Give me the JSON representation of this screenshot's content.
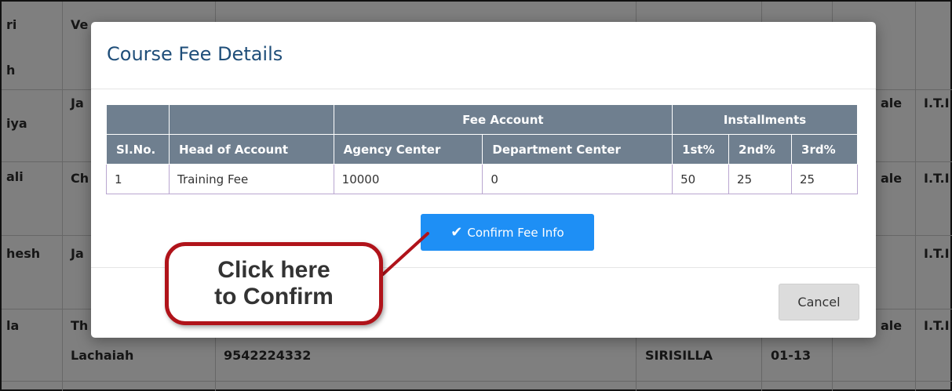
{
  "background_table": {
    "row_fragments": [
      {
        "name_col": "ri",
        "col2": "Ve"
      },
      {
        "name_col": "h"
      },
      {
        "name_col": "iya",
        "col2": "Ja",
        "gender": "ale",
        "trade": "I.T.I"
      },
      {
        "name_col": "ali",
        "col2": "Ch",
        "gender": "ale",
        "trade": "I.T.I"
      },
      {
        "name_col": "hesh",
        "col2": "Ja",
        "trade": "I.T.I"
      },
      {
        "name_col": "la",
        "col2": "Th",
        "gender": "ale",
        "trade": "I.T.I"
      },
      {
        "col2": "Lachaiah",
        "phone": "9542224332",
        "district": "SIRISILLA",
        "date": "01-13"
      }
    ]
  },
  "modal": {
    "title": "Course Fee Details",
    "table": {
      "group_headers": {
        "fee_account": "Fee Account",
        "installments": "Installments"
      },
      "columns": [
        "Sl.No.",
        "Head of Account",
        "Agency Center",
        "Department Center",
        "1st%",
        "2nd%",
        "3rd%"
      ],
      "rows": [
        [
          "1",
          "Training Fee",
          "10000",
          "0",
          "50",
          "25",
          "25"
        ]
      ]
    },
    "confirm_label": "Confirm Fee Info",
    "cancel_label": "Cancel"
  },
  "callout": {
    "line1": "Click here",
    "line2": "to Confirm"
  },
  "colors": {
    "modal_title": "#1f4e79",
    "table_header_bg": "#6f7f8f",
    "confirm_button": "#1e8ff5",
    "cancel_button": "#dcdcdc",
    "callout_border": "#b0131a"
  },
  "icons": {
    "confirm_icon": "check-icon"
  }
}
